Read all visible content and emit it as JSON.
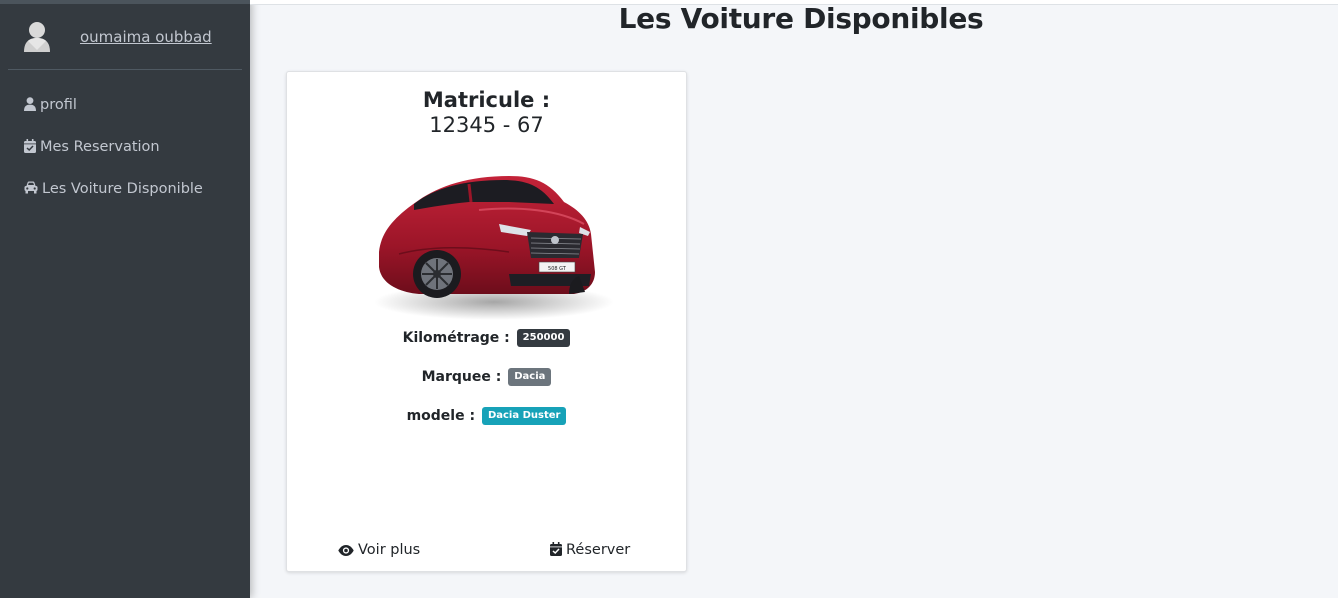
{
  "user": {
    "name": "oumaima oubbad",
    "avatar_icon": "user-avatar-icon"
  },
  "sidebar": {
    "items": [
      {
        "label": "profil",
        "icon": "user-icon"
      },
      {
        "label": "Mes Reservation",
        "icon": "calendar-check-icon"
      },
      {
        "label": "Les Voiture Disponible",
        "icon": "car-icon"
      }
    ]
  },
  "page": {
    "title": "Les Voiture Disponibles"
  },
  "card": {
    "plate_label": "Matricule :",
    "plate_value": "12345 - 67",
    "car_badge_text": "508 GT",
    "mileage_label": "Kilométrage :",
    "mileage_value": "250000",
    "brand_label": "Marquee :",
    "brand_value": "Dacia",
    "model_label": "modele :",
    "model_value": "Dacia Duster",
    "view_more_label": "Voir plus",
    "reserve_label": "Réserver"
  },
  "colors": {
    "sidebar_bg": "#343a40",
    "content_bg": "#f4f6f9",
    "badge_dark": "#343a40",
    "badge_secondary": "#6c757d",
    "badge_info": "#17a2b8",
    "car_red": "#9b1528"
  }
}
